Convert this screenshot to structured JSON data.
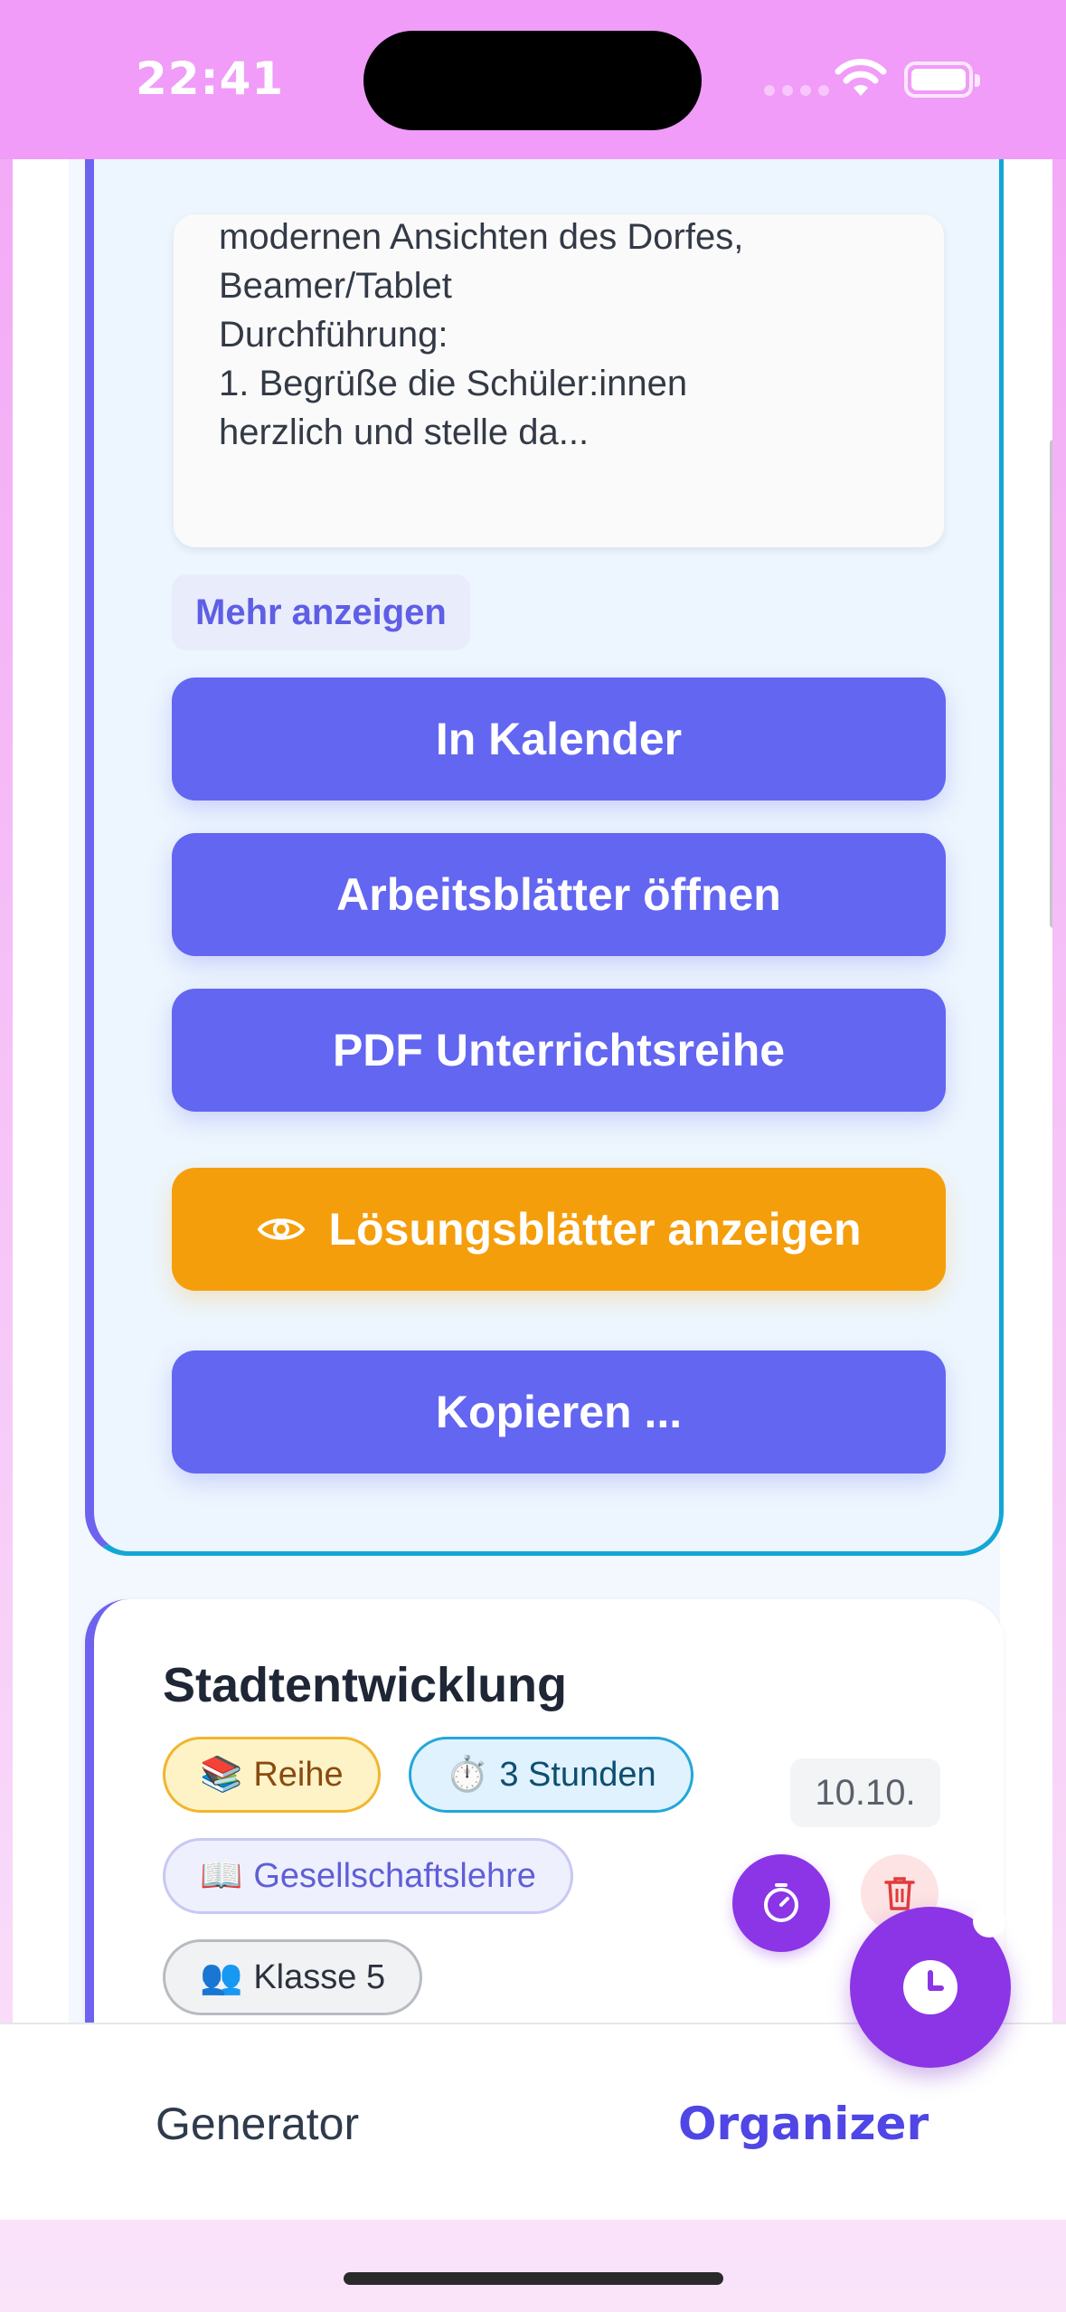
{
  "status_bar": {
    "time": "22:41"
  },
  "lesson_card": {
    "description_lines": [
      "modernen Ansichten des Dorfes,",
      "Beamer/Tablet",
      "Durchführung:",
      "1. Begrüße die Schüler:innen",
      "herzlich und stelle da..."
    ],
    "more_label": "Mehr anzeigen",
    "buttons": {
      "calendar": "In Kalender",
      "worksheets": "Arbeitsblätter öffnen",
      "pdf": "PDF Unterrichtsreihe",
      "solutions": "Lösungsblätter anzeigen",
      "copy": "Kopieren ..."
    }
  },
  "series_card": {
    "title": "Stadtentwicklung",
    "chips": {
      "type_icon": "📚",
      "type": "Reihe",
      "duration_icon": "⏱️",
      "duration": "3 Stunden",
      "subject_icon": "📖",
      "subject": "Gesellschaftslehre",
      "class_icon": "👥",
      "class": "Klasse 5"
    },
    "date": "10.10."
  },
  "tabbar": {
    "generator": "Generator",
    "organizer": "Organizer"
  },
  "colors": {
    "accent": "#6366f1",
    "warning": "#f59e0b",
    "purple": "#8b35e6",
    "card_border": "#12a7d6"
  }
}
